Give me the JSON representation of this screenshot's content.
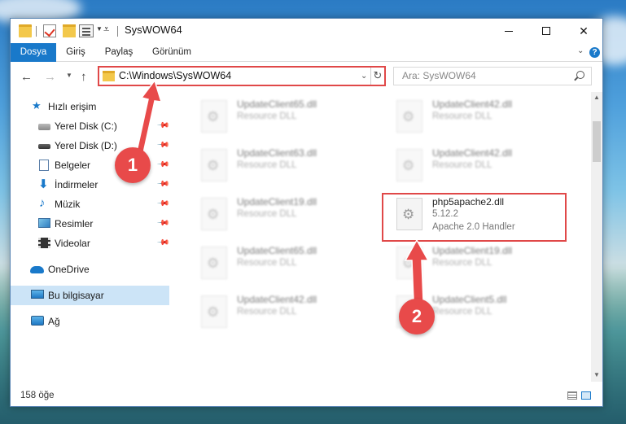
{
  "window": {
    "title": "SysWOW64"
  },
  "ribbon": {
    "tabs": [
      "Dosya",
      "Giriş",
      "Paylaş",
      "Görünüm"
    ],
    "help_label": "?"
  },
  "address": {
    "path": "C:\\Windows\\SysWOW64"
  },
  "search": {
    "placeholder": "Ara: SysWOW64"
  },
  "sidebar": {
    "items": [
      {
        "label": "Hızlı erişim",
        "icon": "star-icon",
        "pinned": false
      },
      {
        "label": "Yerel Disk (C:)",
        "icon": "drive-icon",
        "pinned": true
      },
      {
        "label": "Yerel Disk (D:)",
        "icon": "drive-icon",
        "pinned": true
      },
      {
        "label": "Belgeler",
        "icon": "documents-icon",
        "pinned": true
      },
      {
        "label": "İndirmeler",
        "icon": "download-icon",
        "pinned": true
      },
      {
        "label": "Müzik",
        "icon": "music-icon",
        "pinned": true
      },
      {
        "label": "Resimler",
        "icon": "pictures-icon",
        "pinned": true
      },
      {
        "label": "Videolar",
        "icon": "videos-icon",
        "pinned": true
      },
      {
        "label": "OneDrive",
        "icon": "onedrive-icon",
        "pinned": false
      },
      {
        "label": "Bu bilgisayar",
        "icon": "pc-icon",
        "pinned": false,
        "selected": true
      },
      {
        "label": "Ağ",
        "icon": "network-icon",
        "pinned": false
      }
    ]
  },
  "files": {
    "left": [
      {
        "name": "UpdateClient65.dll",
        "desc": "Resource DLL"
      },
      {
        "name": "UpdateClient63.dll",
        "desc": "Resource DLL"
      },
      {
        "name": "UpdateClient19.dll",
        "desc": "Resource DLL"
      },
      {
        "name": "UpdateClient65.dll",
        "desc": "Resource DLL"
      },
      {
        "name": "UpdateClient42.dll",
        "desc": "Resource DLL"
      }
    ],
    "right": [
      {
        "name": "UpdateClient42.dll",
        "desc": "Resource DLL"
      },
      {
        "name": "UpdateClient42.dll",
        "desc": "Resource DLL"
      },
      {
        "name": "UpdateClient19.dll",
        "desc": "Resource DLL"
      },
      {
        "name": "UpdateClient5.dll",
        "desc": "Resource DLL"
      }
    ],
    "highlighted": {
      "name": "php5apache2.dll",
      "version": "5.12.2",
      "desc": "Apache 2.0 Handler"
    }
  },
  "status": {
    "item_count": "158 öğe"
  },
  "annotations": {
    "step1": "1",
    "step2": "2",
    "color": "#e84a4a"
  }
}
